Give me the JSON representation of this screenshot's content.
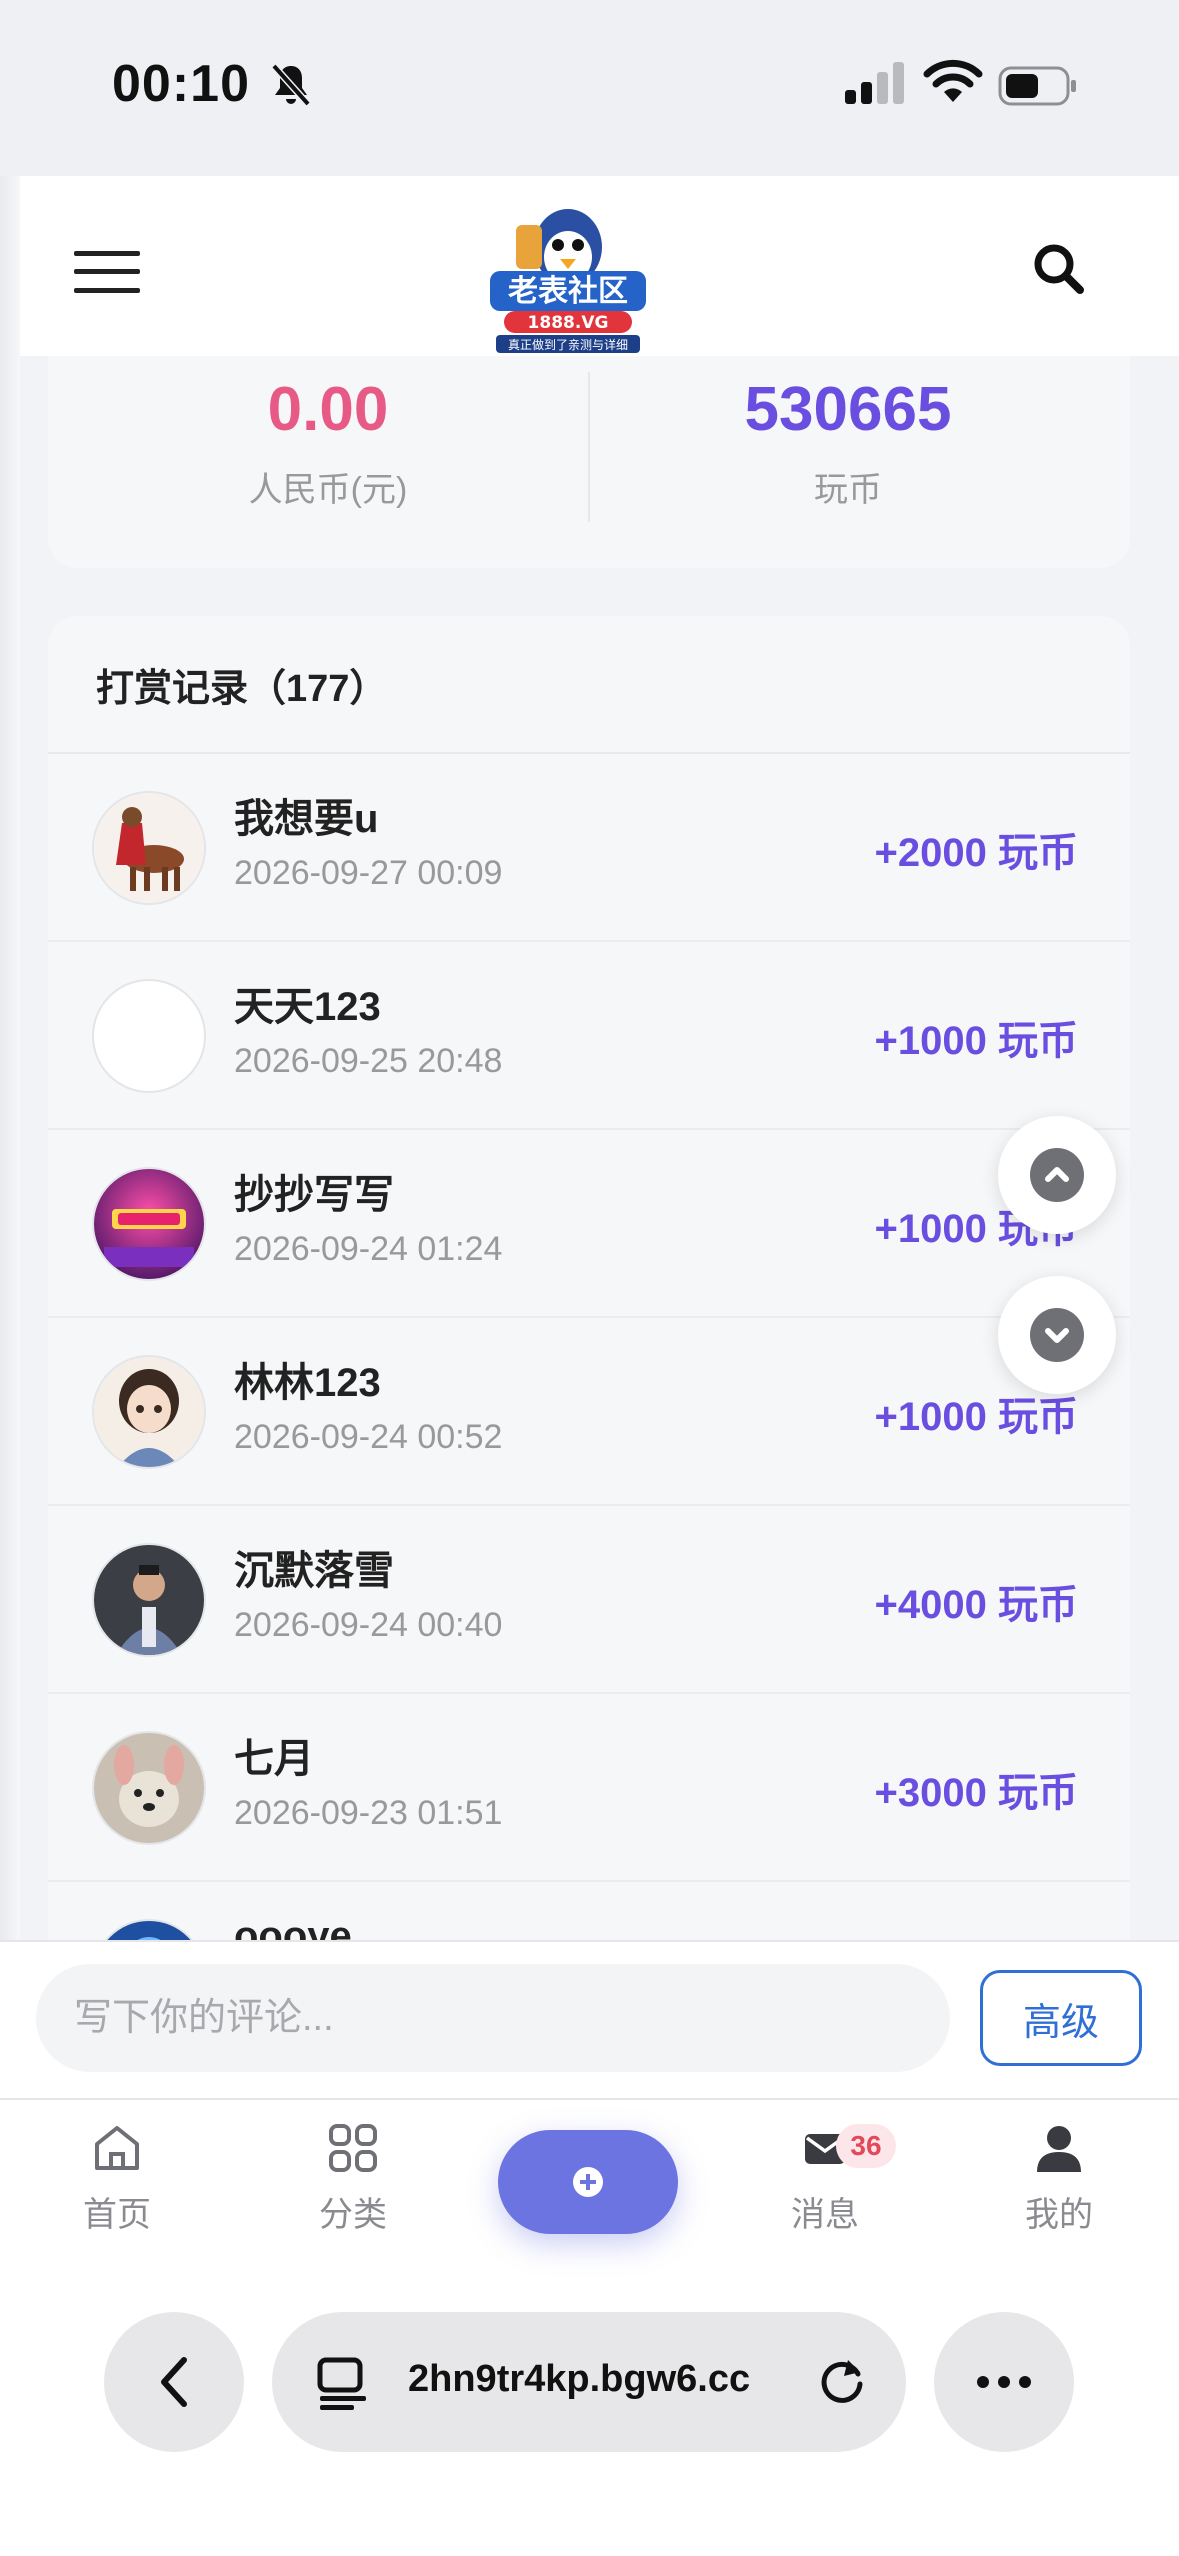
{
  "status_bar": {
    "time": "00:10"
  },
  "header": {
    "logo_title": "老表社区",
    "logo_domain": "1888.VG",
    "logo_slogan": "真正做到了亲测与详细"
  },
  "balance": {
    "rmb": {
      "value": "0.00",
      "label": "人民币(元)",
      "color": "#e85a86"
    },
    "coins": {
      "value": "530665",
      "label": "玩币",
      "color": "#6a4ee0"
    }
  },
  "rewards": {
    "title": "打赏记录（177）",
    "rows": [
      {
        "name": "我想要u",
        "time": "2026-09-27 00:09",
        "amount": "+2000 玩币",
        "avatar": "horse-avatar"
      },
      {
        "name": "天天123",
        "time": "2026-09-25 20:48",
        "amount": "+1000 玩币",
        "avatar": "blank-avatar"
      },
      {
        "name": "抄抄写写",
        "time": "2026-09-24 01:24",
        "amount": "+1000 玩币",
        "avatar": "pink-banner-avatar"
      },
      {
        "name": "林林123",
        "time": "2026-09-24 00:52",
        "amount": "+1000 玩币",
        "avatar": "girl-avatar"
      },
      {
        "name": "沉默落雪",
        "time": "2026-09-24 00:40",
        "amount": "+4000 玩币",
        "avatar": "man-avatar"
      },
      {
        "name": "七月",
        "time": "2026-09-23 01:51",
        "amount": "+3000 玩币",
        "avatar": "dog-avatar"
      },
      {
        "name": "oooye",
        "time": "",
        "amount": "",
        "avatar": "blue-avatar"
      }
    ]
  },
  "comment": {
    "placeholder": "写下你的评论...",
    "advanced_label": "高级"
  },
  "tabbar": {
    "home": "首页",
    "category": "分类",
    "messages": "消息",
    "messages_badge": "36",
    "mine": "我的"
  },
  "browser": {
    "url": "2hn9tr4kp.bgw6.cc"
  }
}
